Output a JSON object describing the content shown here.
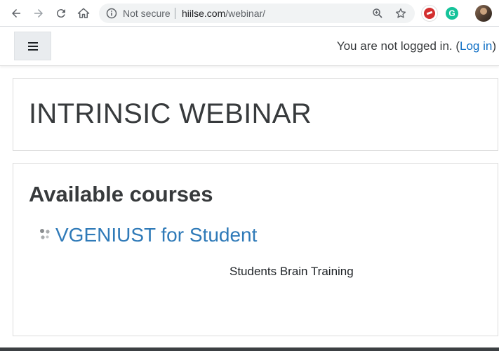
{
  "browser": {
    "security_label": "Not secure",
    "url_host": "hiilse.com",
    "url_path": "/webinar/",
    "grammarly_letter": "G"
  },
  "navbar": {
    "login_prefix": "You are not logged in. (",
    "login_link": "Log in",
    "login_suffix": ")"
  },
  "page": {
    "title": "INTRINSIC WEBINAR"
  },
  "courses": {
    "heading": "Available courses",
    "items": [
      {
        "name": "VGENIUST for Student",
        "summary": "Students Brain Training"
      }
    ]
  },
  "colors": {
    "link": "#0f6fc5",
    "course_link": "#2f7ab8",
    "text": "#373a3c"
  },
  "icons": [
    "back-arrow-icon",
    "forward-arrow-icon",
    "reload-icon",
    "home-icon",
    "info-icon",
    "zoom-icon",
    "star-icon",
    "hamburger-menu-icon",
    "course-icon"
  ]
}
